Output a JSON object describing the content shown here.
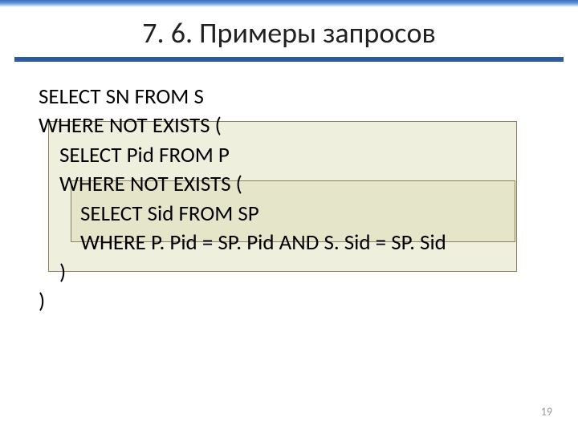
{
  "header": {
    "title": "7. 6. Примеры запросов"
  },
  "code": {
    "l1_a": "SELECT ",
    "l1_b": "SN ",
    "l1_c": "FROM ",
    "l1_d": "S",
    "l2_a": "WHERE NOT EXISTS ",
    "l2_b": "(",
    "l3_a": "SELECT ",
    "l3_b": "Pid ",
    "l3_c": "FROM ",
    "l3_d": "P",
    "l4_a": "WHERE NOT EXISTS ",
    "l4_b": "(",
    "l5_a": "SELECT ",
    "l5_b": "Sid ",
    "l5_c": "FROM ",
    "l5_d": "SP",
    "l6_a": "WHERE ",
    "l6_b": "P. Pid = SP. Pid ",
    "l6_c": "AND ",
    "l6_d": "S. Sid = SP. Sid",
    "l7": ")",
    "l8": ")"
  },
  "page_number": "19"
}
